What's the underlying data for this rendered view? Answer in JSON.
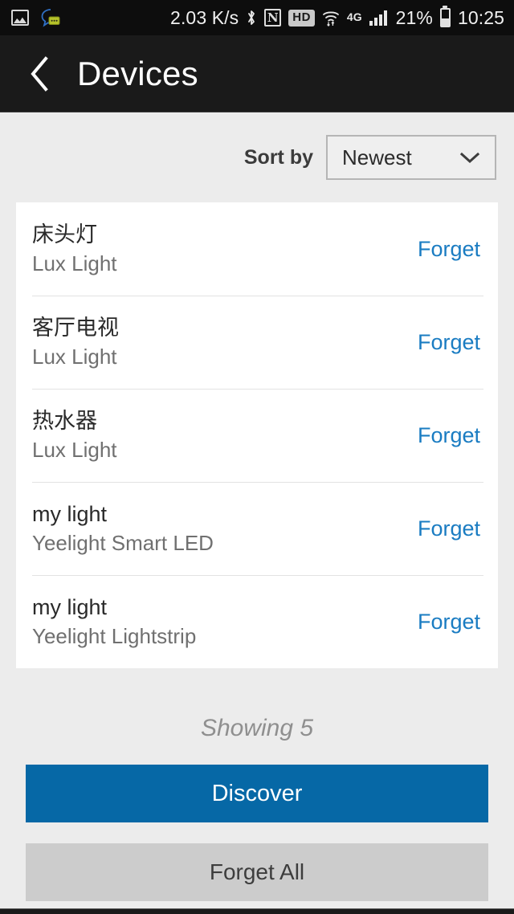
{
  "status_bar": {
    "network_speed": "2.03 K/s",
    "hd_badge": "HD",
    "mobile_network": "4G",
    "battery_percent": "21%",
    "clock": "10:25",
    "icons": [
      "gallery-icon",
      "chat-bubble-icon",
      "bluetooth-icon",
      "nfc-icon",
      "wifi-icon",
      "signal-bars-icon",
      "battery-icon"
    ]
  },
  "app_bar": {
    "back_icon": "chevron-left-icon",
    "title": "Devices"
  },
  "sort": {
    "label": "Sort by",
    "selected": "Newest",
    "chevron_icon": "chevron-down-icon"
  },
  "devices": [
    {
      "name": "床头灯",
      "type": "Lux Light",
      "action": "Forget"
    },
    {
      "name": "客厅电视",
      "type": "Lux Light",
      "action": "Forget"
    },
    {
      "name": "热水器",
      "type": "Lux Light",
      "action": "Forget"
    },
    {
      "name": "my light",
      "type": "Yeelight Smart LED",
      "action": "Forget"
    },
    {
      "name": "my light",
      "type": "Yeelight Lightstrip",
      "action": "Forget"
    }
  ],
  "footer": {
    "showing": "Showing 5",
    "discover_label": "Discover",
    "forget_all_label": "Forget All"
  },
  "colors": {
    "accent_blue": "#0668a6",
    "link_blue": "#1a7cc2",
    "page_bg": "#ececec",
    "app_bar_bg": "#1a1a1a",
    "status_bar_bg": "#0d0d0d",
    "secondary_btn": "#cccccc"
  }
}
